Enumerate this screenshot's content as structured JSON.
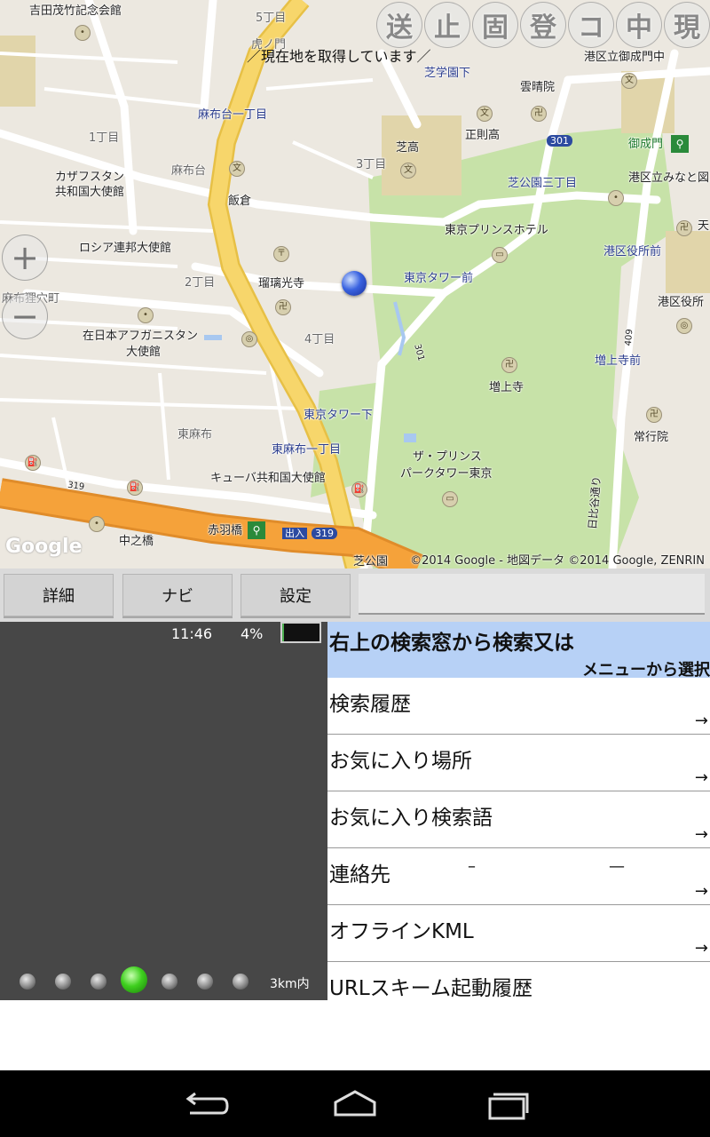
{
  "map": {
    "status_message": "／現在地を取得しています／",
    "copyright": "©2014 Google - 地図データ ©2014 Google, ZENRIN",
    "google_logo": "Google",
    "zoom_in": "+",
    "zoom_out": "−",
    "top_buttons": [
      "送",
      "止",
      "固",
      "登",
      "コ",
      "中",
      "現"
    ],
    "labels": [
      "吉田茂竹記念会館",
      "5丁目",
      "虎ノ門",
      "港区立御成門中",
      "芝学園下",
      "雲晴院",
      "麻布台一丁目",
      "正則高",
      "1丁目",
      "芝高",
      "301",
      "御成門",
      "3丁目",
      "麻布台",
      "カザフスタン",
      "共和国大使館",
      "飯倉",
      "芝公園三丁目",
      "港区立みなと図",
      "東京プリンスホテル",
      "天",
      "ロシア連邦大使館",
      "港区役所前",
      "2丁目",
      "瑠璃光寺",
      "東京タワー前",
      "麻布狸穴町",
      "港区役所",
      "在日本アフガニスタン",
      "大使館",
      "4丁目",
      "301",
      "409",
      "増上寺前",
      "増上寺",
      "東京タワー下",
      "東麻布",
      "常行院",
      "東麻布一丁目",
      "ザ・プリンス",
      "パークタワー東京",
      "キューバ共和国大使館",
      "319",
      "日比谷通り",
      "赤羽橋",
      "出入",
      "319",
      "中之橋",
      "芝公園"
    ]
  },
  "toolbar": {
    "detail": "詳細",
    "navi": "ナビ",
    "settings": "設定"
  },
  "status": {
    "time": "11:46",
    "battery": "4%",
    "battery_level": 0.04
  },
  "dots": {
    "count": 7,
    "active_index": 3,
    "range": "3km内"
  },
  "panel": {
    "header_line1": "右上の検索窓から検索又は",
    "header_line2": "メニューから選択",
    "arrow": "→",
    "items": [
      {
        "label": "検索履歴"
      },
      {
        "label": "お気に入り場所"
      },
      {
        "label": "お気に入り検索語"
      },
      {
        "label": "連絡先",
        "dash1": "–",
        "dash2": "—"
      },
      {
        "label": "オフラインKML"
      },
      {
        "label": "URLスキーム起動履歴"
      }
    ]
  },
  "colors": {
    "map_bg": "#ece8e0",
    "park": "#c7e2a8",
    "highway": "#f7d66b",
    "expressway": "#f5a23a",
    "panel_header": "#b7d1f6",
    "left_panel": "#474747"
  },
  "icons": {
    "back": "back-icon",
    "home": "home-icon",
    "recents": "recents-icon"
  }
}
